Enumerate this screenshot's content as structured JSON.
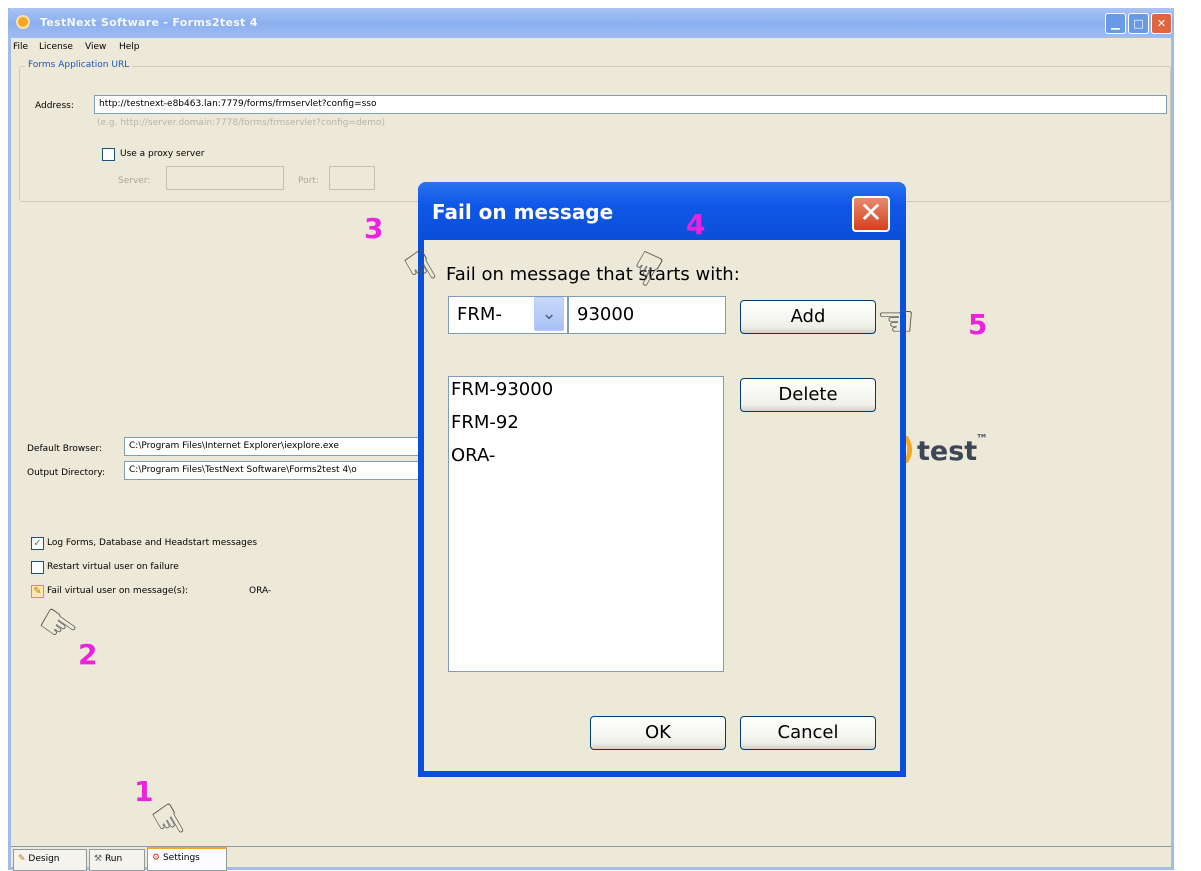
{
  "window": {
    "title": "TestNext Software - Forms2test 4",
    "min_glyph": "▁",
    "max_glyph": "□",
    "close_glyph": "✕"
  },
  "menu": [
    "File",
    "License",
    "View",
    "Help"
  ],
  "url_group": {
    "title": "Forms Application URL",
    "address_label": "Address:",
    "address_value": "http://testnext-e8b463.lan:7779/forms/frmservlet?config=sso",
    "address_hint": "(e.g. http://server.domain:7778/forms/frmservlet?config=demo)",
    "proxy_label": "Use a proxy server",
    "server_label": "Server:",
    "port_label": "Port:"
  },
  "settings": {
    "browser_label": "Default Browser:",
    "browser_value": "C:\\Program Files\\Internet Explorer\\iexplore.exe",
    "output_label": "Output Directory:",
    "output_value": "C:\\Program Files\\TestNext Software\\Forms2test 4\\o",
    "log_label": "Log Forms, Database and Headstart messages",
    "log_checked": "✓",
    "restart_label": "Restart virtual user on failure",
    "fail_label": "Fail virtual user on message(s):",
    "fail_value": "ORA-",
    "fail_edit_glyph": "✎"
  },
  "logo": {
    "text": "test",
    "tm": "™"
  },
  "tabs": [
    {
      "label": "Design",
      "glyph": "✎"
    },
    {
      "label": "Run",
      "glyph": "⚒"
    },
    {
      "label": "Settings",
      "glyph": "⚙"
    }
  ],
  "dialog": {
    "title": "Fail on message",
    "close_glyph": "✕",
    "prompt": "Fail on message that starts with:",
    "prefix_selected": "FRM-",
    "combo_arrow_glyph": "⌄",
    "message_value": "93000",
    "add_label": "Add",
    "delete_label": "Delete",
    "messages": [
      "FRM-93000",
      "FRM-92",
      "ORA-"
    ],
    "ok_label": "OK",
    "cancel_label": "Cancel"
  },
  "annotations": {
    "hand_glyph": "☞",
    "steps": [
      "1",
      "2",
      "3",
      "4",
      "5"
    ]
  }
}
